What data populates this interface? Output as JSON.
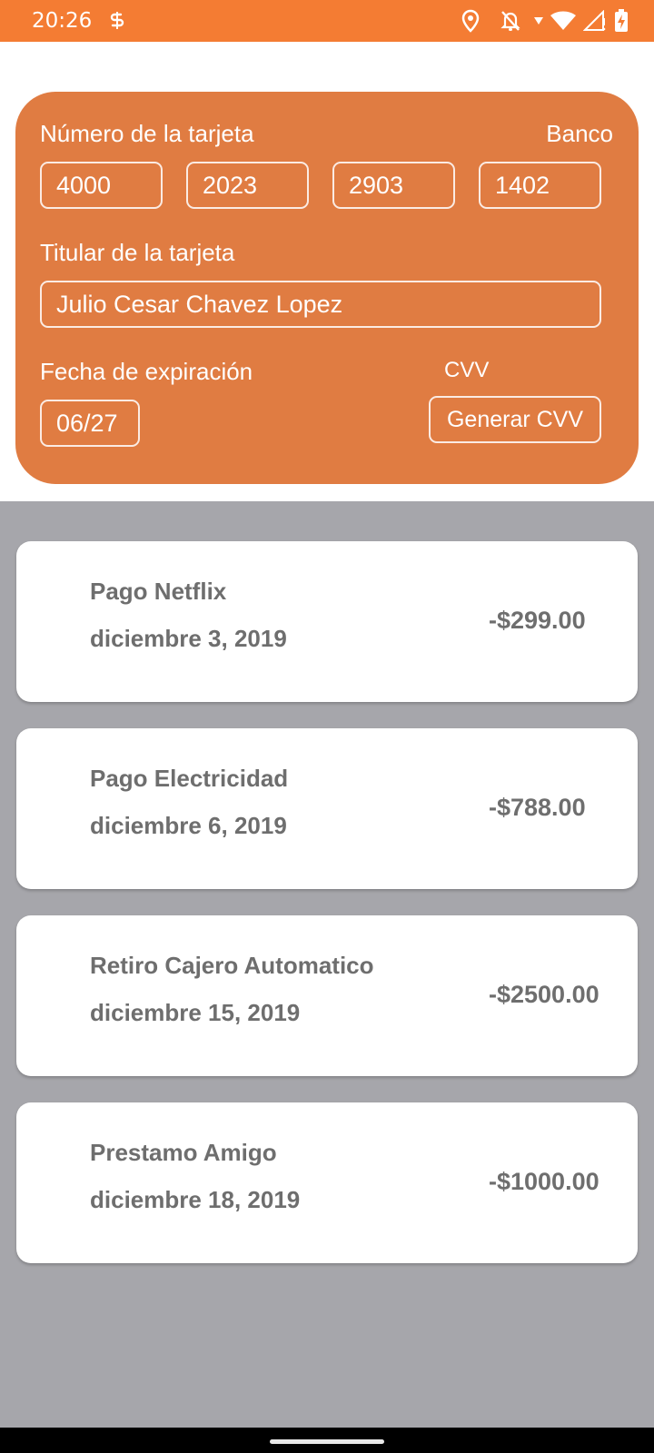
{
  "status_bar": {
    "time": "20:26",
    "icons": [
      "s-notification-icon",
      "location-icon",
      "notifications-off-icon",
      "wifi-icon",
      "signal-icon",
      "battery-icon"
    ],
    "color": "#f47c33"
  },
  "card": {
    "color": "#e07c42",
    "number_label": "Número de la tarjeta",
    "bank_label": "Banco",
    "number_parts": [
      "4000",
      "2023",
      "2903",
      "1402"
    ],
    "holder_label": "Titular de la tarjeta",
    "holder_value": "Julio Cesar Chavez Lopez",
    "expiry_label": "Fecha de expiración",
    "expiry_value": "06/27",
    "cvv_label": "CVV",
    "cvv_button": "Generar CVV"
  },
  "transactions": [
    {
      "title": "Pago Netflix",
      "date": "diciembre 3, 2019",
      "amount": "-$299.00"
    },
    {
      "title": "Pago Electricidad",
      "date": "diciembre 6, 2019",
      "amount": "-$788.00"
    },
    {
      "title": "Retiro Cajero Automatico",
      "date": "diciembre 15, 2019",
      "amount": "-$2500.00"
    },
    {
      "title": "Prestamo Amigo",
      "date": "diciembre 18, 2019",
      "amount": "-$1000.00"
    }
  ],
  "colors": {
    "list_background": "#a6a6ab",
    "text_gray": "#6e6e6e"
  }
}
